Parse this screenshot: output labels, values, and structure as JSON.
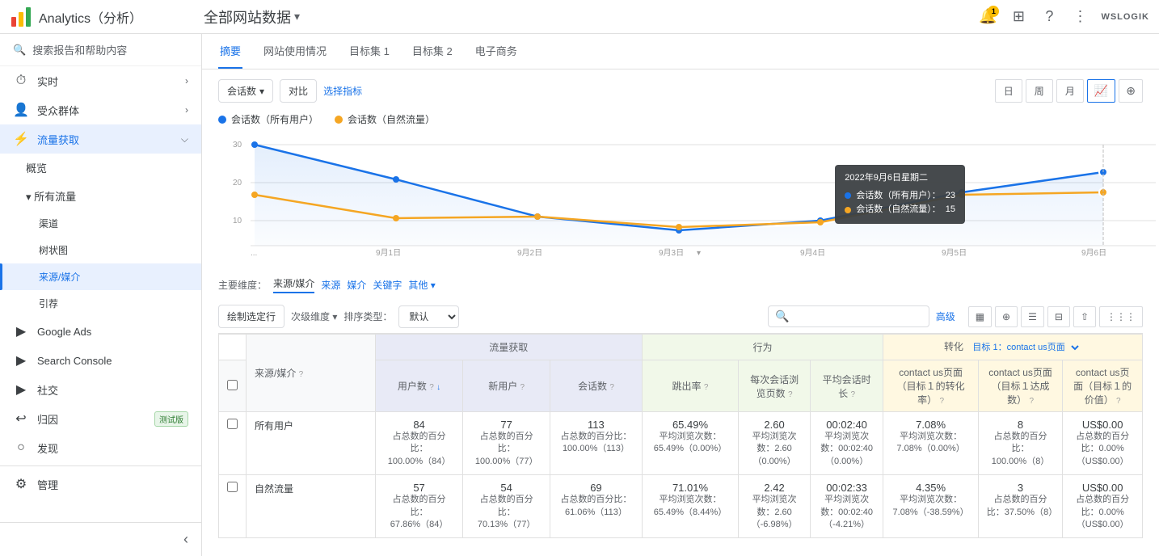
{
  "app": {
    "title": "Analytics（分析）",
    "logo_colors": [
      "#EA4335",
      "#FBBC04",
      "#34A853",
      "#4285F4"
    ],
    "page_title": "全部网站数据",
    "brand_text": "WSLOGIK"
  },
  "topbar": {
    "notification_count": "1",
    "icons": [
      "notification",
      "grid",
      "help",
      "more"
    ]
  },
  "sidebar": {
    "search_placeholder": "搜索报告和帮助内容",
    "items": [
      {
        "id": "realtime",
        "label": "实时",
        "icon": "⏱",
        "level": 1,
        "has_arrow": true
      },
      {
        "id": "audience",
        "label": "受众群体",
        "icon": "👤",
        "level": 1,
        "has_arrow": true
      },
      {
        "id": "acquisition",
        "label": "流量获取",
        "icon": "⚡",
        "level": 1,
        "has_arrow": true,
        "active": true
      },
      {
        "id": "overview",
        "label": "概览",
        "level": 2
      },
      {
        "id": "all-traffic",
        "label": "▾ 所有流量",
        "level": 2,
        "expanded": true
      },
      {
        "id": "channels",
        "label": "渠道",
        "level": 3
      },
      {
        "id": "treemap",
        "label": "树状图",
        "level": 3
      },
      {
        "id": "source-medium",
        "label": "来源/媒介",
        "level": 3,
        "active": true
      },
      {
        "id": "referrals",
        "label": "引荐",
        "level": 3
      },
      {
        "id": "google-ads",
        "label": "Google Ads",
        "icon": "▶",
        "level": 1,
        "has_arrow": true
      },
      {
        "id": "search-console",
        "label": "Search Console",
        "icon": "▶",
        "level": 1,
        "has_arrow": true
      },
      {
        "id": "social",
        "label": "社交",
        "icon": "▶",
        "level": 1,
        "has_arrow": true
      },
      {
        "id": "attribution-beta",
        "label": "归因",
        "level": 1,
        "badge": "测试版"
      },
      {
        "id": "discover",
        "label": "发现",
        "icon": "○",
        "level": 1
      },
      {
        "id": "admin",
        "label": "管理",
        "icon": "⚙",
        "level": 1
      }
    ],
    "collapse_label": "‹"
  },
  "tabs": [
    "摘要",
    "网站使用情况",
    "目标集 1",
    "目标集 2",
    "电子商务"
  ],
  "active_tab": "摘要",
  "chart": {
    "metric_btn": "会话数",
    "compare_btn": "对比",
    "select_metric_btn": "选择指标",
    "view_buttons": [
      "日",
      "周",
      "月"
    ],
    "active_view": "日",
    "legend": [
      {
        "label": "会话数（所有用户）",
        "color": "#1a73e8"
      },
      {
        "label": "会话数（自然流量）",
        "color": "#f5a623"
      }
    ],
    "tooltip": {
      "date": "2022年9月6日星期二",
      "rows": [
        {
          "label": "会话数（所有用户）：",
          "value": "23",
          "color": "#1a73e8"
        },
        {
          "label": "会话数（自然流量）：",
          "value": "15",
          "color": "#f5a623"
        }
      ]
    },
    "x_labels": [
      "...",
      "9月1日",
      "9月2日",
      "9月3日",
      "9月4日",
      "9月5日",
      "9月6日"
    ],
    "y_labels": [
      "30",
      "20",
      "10"
    ],
    "series": {
      "all_users": [
        29,
        21,
        10,
        7,
        9,
        17,
        23
      ],
      "organic": [
        14,
        9,
        10,
        6,
        8,
        14,
        15
      ]
    }
  },
  "dimensions": {
    "prefix": "主要维度：",
    "items": [
      "来源/媒介",
      "来源",
      "媒介",
      "关键字",
      "其他"
    ],
    "active": "来源/媒介"
  },
  "toolbar": {
    "plot_btn": "绘制选定行",
    "secondary_dim_label": "次级维度",
    "sort_type_label": "排序类型：",
    "sort_default": "默认",
    "search_placeholder": "",
    "advanced_btn": "高级"
  },
  "table": {
    "groups": {
      "acquisition": "流量获取",
      "behavior": "行为",
      "conversion": "转化",
      "conversion_target": "目标 1：contact us页面"
    },
    "columns": [
      {
        "id": "source",
        "label": "来源/媒介",
        "group": "dim"
      },
      {
        "id": "users",
        "label": "用户数",
        "group": "acquisition",
        "sort": true
      },
      {
        "id": "new_users",
        "label": "新用户",
        "group": "acquisition"
      },
      {
        "id": "sessions",
        "label": "会话数",
        "group": "acquisition"
      },
      {
        "id": "bounce",
        "label": "跳出率",
        "group": "behavior"
      },
      {
        "id": "pages_per_session",
        "label": "每次会话浏览页数",
        "group": "behavior"
      },
      {
        "id": "avg_session",
        "label": "平均会话时长",
        "group": "behavior"
      },
      {
        "id": "conv_rate",
        "label": "contact us页面（目标1的转化率）",
        "group": "conversion"
      },
      {
        "id": "completions",
        "label": "contact us页面（目标1达成数）",
        "group": "conversion"
      },
      {
        "id": "value",
        "label": "contact us页面（目标1的价值）",
        "group": "conversion"
      }
    ],
    "rows": [
      {
        "source": "所有用户",
        "users": "84",
        "users_sub": "占总数的百分比：100.00%（84）",
        "new_users": "77",
        "new_users_sub": "占总数的百分比：100.00%（77）",
        "sessions": "113",
        "sessions_sub": "占总数的百分比：100.00%（113）",
        "bounce": "65.49%",
        "bounce_sub": "平均浏览次数：65.49%（0.00%）",
        "pages": "2.60",
        "pages_sub": "平均浏览次数：2.60（0.00%）",
        "avg_time": "00:02:40",
        "avg_time_sub": "平均浏览次数：00:02:40（0.00%）",
        "conv_rate": "7.08%",
        "conv_rate_sub": "平均浏览次数：7.08%（0.00%）",
        "completions": "8",
        "completions_sub": "占总数的百分比：100.00%（8）",
        "value": "US$0.00",
        "value_sub": "占总数的百分比：0.00%（US$0.00）"
      },
      {
        "source": "自然流量",
        "users": "57",
        "users_sub": "占总数的百分比：67.86%（84）",
        "new_users": "54",
        "new_users_sub": "占总数的百分比：70.13%（77）",
        "sessions": "69",
        "sessions_sub": "占总数的百分比：61.06%（113）",
        "bounce": "71.01%",
        "bounce_sub": "平均浏览次数：65.49%（8.44%）",
        "pages": "2.42",
        "pages_sub": "平均浏览次数：2.60（-6.98%）",
        "avg_time": "00:02:33",
        "avg_time_sub": "平均浏览次数：00:02:40（-4.21%）",
        "conv_rate": "4.35%",
        "conv_rate_sub": "平均浏览次数：7.08%（-38.59%）",
        "completions": "3",
        "completions_sub": "占总数的百分比：37.50%（8）",
        "value": "US$0.00",
        "value_sub": "占总数的百分比：0.00%（US$0.00）"
      }
    ]
  }
}
